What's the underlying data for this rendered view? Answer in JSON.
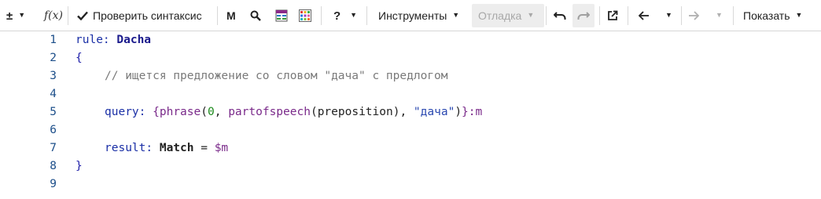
{
  "toolbar": {
    "plus_minus": "±",
    "fx": "f(x)",
    "check_syntax": "Проверить синтаксис",
    "m_label": "M",
    "help": "?",
    "tools": "Инструменты",
    "debug": "Отладка",
    "show": "Показать"
  },
  "editor": {
    "line_numbers": [
      "1",
      "2",
      "3",
      "4",
      "5",
      "6",
      "7",
      "8",
      "9"
    ],
    "line1": {
      "kw": "rule:",
      "name": "Dacha"
    },
    "line2": {
      "brace": "{"
    },
    "line3": {
      "comment": "// ищется предложение со словом \"дача\" с предлогом"
    },
    "line5": {
      "kw": "query:",
      "open": "{",
      "phrase": "phrase",
      "p1": "(",
      "zero": "0",
      "comma1": ", ",
      "pos": "partofspeech",
      "p2": "(",
      "prep": "preposition",
      "p3": "), ",
      "str": "\"дача\"",
      "p4": ")",
      "close": "}",
      "var": ":m"
    },
    "line7": {
      "kw": "result:",
      "match": "Match",
      "eq": " = ",
      "var": "$m"
    },
    "line8": {
      "brace": "}"
    }
  }
}
